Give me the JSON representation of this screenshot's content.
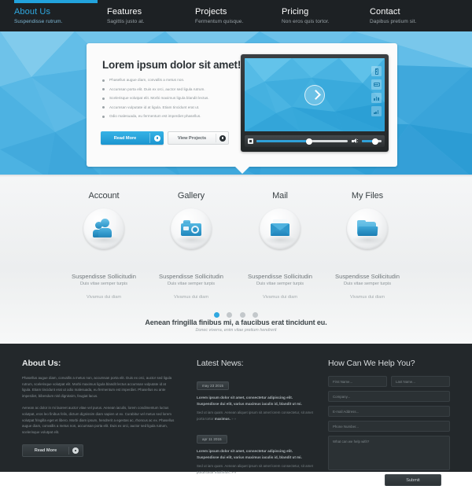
{
  "nav": {
    "accent_color": "#22a3dd",
    "items": [
      {
        "title": "About Us",
        "sub": "Suspendisse rutrum.",
        "active": true
      },
      {
        "title": "Features",
        "sub": "Sagittis justo at.",
        "active": false
      },
      {
        "title": "Projects",
        "sub": "Fermentum quisque.",
        "active": false
      },
      {
        "title": "Pricing",
        "sub": "Non eros quis tortor.",
        "active": false
      },
      {
        "title": "Contact",
        "sub": "Dapibus pretium sit.",
        "active": false
      }
    ]
  },
  "hero": {
    "title": "Lorem ipsum dolor sit amet!",
    "bullets": [
      "Phasellus augue diam, convallis a metus non.",
      "Accumsan porta elit. Duis ex orci, auctor sed ligula rutrum.",
      "Scelerisque volutpat elit. Morbi maximus ligula blandit lectus.",
      "Accumsan vulputate id at ligula. Etiam tincidunt erat ut.",
      "Odio malesuada, eu fermentum est imperdiet phasellus."
    ],
    "read_more": "Read More",
    "view_projects": "View Projects",
    "player": {
      "play_label": "play-button",
      "side_icons": [
        "battery-icon",
        "card-icon",
        "bar-chart-icon",
        "signal-icon"
      ],
      "progress_percent": 58,
      "volume_percent": 64
    }
  },
  "features": {
    "items": [
      {
        "name": "Account",
        "icon": "account-icon",
        "desc": "Suspendisse Sollicitudin",
        "sub": "Duis vitae semper turpis",
        "note": "Vivamus dui diam"
      },
      {
        "name": "Gallery",
        "icon": "camera-icon",
        "desc": "Suspendisse Sollicitudin",
        "sub": "Duis vitae semper turpis",
        "note": "Vivamus dui diam"
      },
      {
        "name": "Mail",
        "icon": "envelope-icon",
        "desc": "Suspendisse Sollicitudin",
        "sub": "Duis vitae semper turpis",
        "note": "Vivamus dui diam"
      },
      {
        "name": "My Files",
        "icon": "folder-icon",
        "desc": "Suspendisse Sollicitudin",
        "sub": "Duis vitae semper turpis",
        "note": "Vivamus dui diam"
      }
    ]
  },
  "carousel": {
    "dots": 4,
    "active_index": 0,
    "active_color": "#2fa8e0",
    "quote": "Aenean fringilla finibus mi, a faucibus erat tincidunt eu.",
    "quote_sub": "Donec viverra, enim vitae pretium hendrerit"
  },
  "footer": {
    "about": {
      "heading": "About Us:",
      "paragraph1": "Phasellus augue diam, convallis a metus non, accumsan porta elit. Duis ex orci, auctor sed ligula rutrum, scelerisque volutpat elit. Morbi maximus ligula blandit lectus accumsan vulputate id at ligula. Etiam tincidunt erat ut odio malesuada, eu fermentum est imperdiet. Phasellus eu ante imperdiet, bibendum nisl dignissim, feugiat lacus.",
      "paragraph2": "Aenean ac dolor in mi laoreet auctor vitae vel purus. Aenean iaculis, lorem condimentum luctus volutpat, eros leo finibus felis, dictum dignissim diam sapien ut ex. Curabitur vel metus sed lorem volutpat fringilla eget et libero. Morbi diam ipsum, hendrerit a egestas ac, rhoncus ac ex. Phasellus augue diam, convallis a metus non, accumsan porta elit. Duis ex orci, auctor sed ligula rutrum, scelerisque volutpat elit.",
      "read_more": "Read More"
    },
    "news": {
      "heading": "Latest News:",
      "items": [
        {
          "date": "may 23 2015",
          "title": "Lorem ipsum dolor sit amet, consectetur adipiscing elit. Suspendisse dui elit, varius maximus iaculis id, blandit ut mi.",
          "body": "Sed ut iam quam. Aenean aliquet ipsum sit amet lorem consectetur, sit amet porta tortor ",
          "body_bold": "maximus.",
          "arrows": " » »"
        },
        {
          "date": "apr 11 2015",
          "title": "Lorem ipsum dolor sit amet, consectetur adipiscing elit. Suspendisse dui elit, varius maximus iaculis id, blandit ut mi.",
          "body": "Sed ut iam quam. Aenean aliquet ipsum sit amet lorem consectetur, sit amet porta tortor ",
          "body_bold": "maximus.",
          "arrows": " » »"
        }
      ]
    },
    "form": {
      "heading": "How Can We Help You?",
      "first_name": "First Name...",
      "last_name": "Last Name...",
      "company": "Company...",
      "email": "E-mail Address...",
      "phone": "Phone Number...",
      "message": "What can we help with?",
      "submit": "Submit"
    }
  }
}
